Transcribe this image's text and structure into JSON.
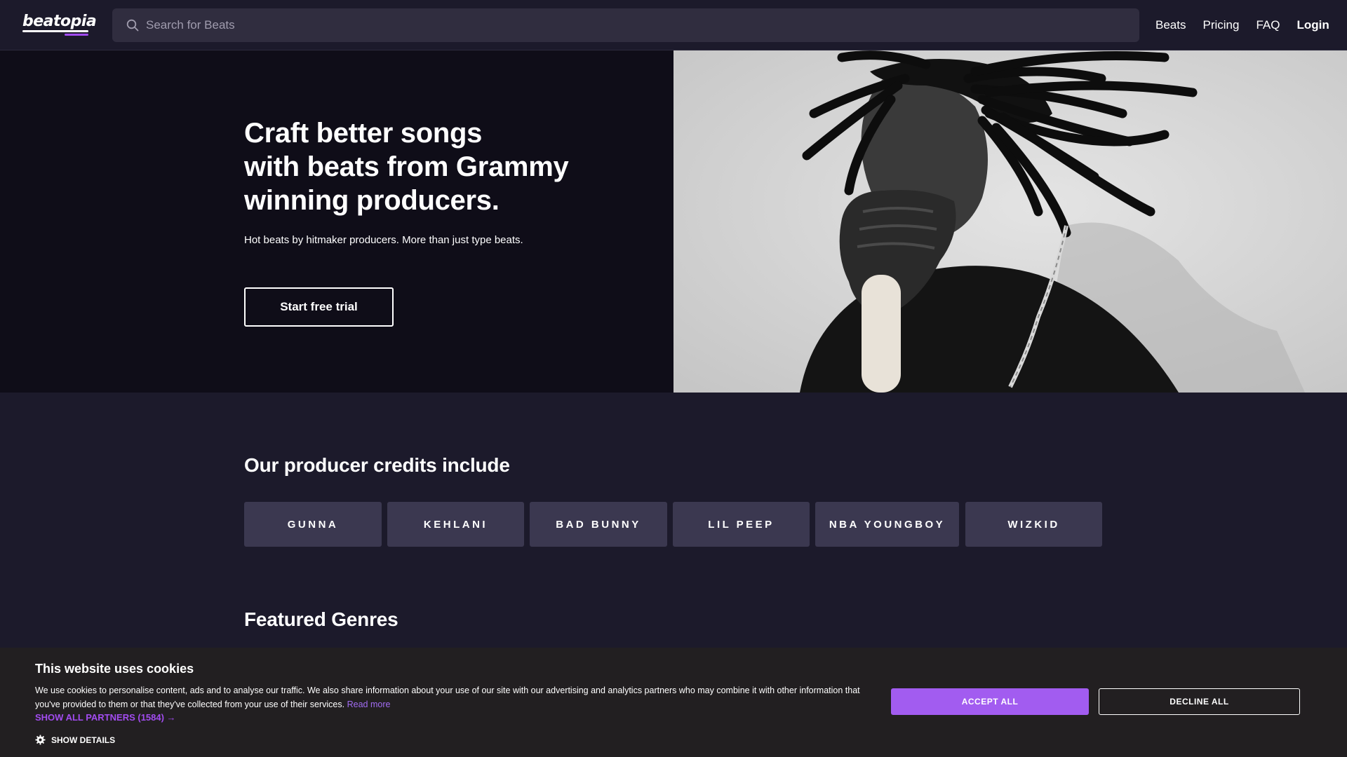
{
  "header": {
    "logo": "beatopia",
    "search_placeholder": "Search for Beats",
    "nav": [
      "Beats",
      "Pricing",
      "FAQ",
      "Login"
    ]
  },
  "hero": {
    "title_lines": [
      "Craft better songs",
      "with beats from Grammy",
      "winning producers."
    ],
    "subtitle": "Hot beats by hitmaker producers. More than just type beats.",
    "cta": "Start free trial"
  },
  "credits": {
    "title": "Our producer credits include",
    "items": [
      "GUNNA",
      "KEHLANI",
      "BAD BUNNY",
      "LIL PEEP",
      "NBA YOUNGBOY",
      "WIZKID"
    ]
  },
  "genres": {
    "title": "Featured Genres"
  },
  "cookie": {
    "title": "This website uses cookies",
    "body": "We use cookies to personalise content, ads and to analyse our traffic. We also share information about your use of our site with our advertising and analytics partners who may combine it with other information that you've provided to them or that they've collected from your use of their services.",
    "read_more": "Read more",
    "partners": "SHOW ALL PARTNERS (1584) →",
    "show_details": "SHOW DETAILS",
    "accept": "ACCEPT ALL",
    "decline": "DECLINE ALL"
  },
  "colors": {
    "background": "#1c1a2b",
    "hero_background": "#0f0d18",
    "accent": "#a24cf0",
    "chip": "#3b3850",
    "cookie_background": "#221f21"
  },
  "icons": [
    "search-icon",
    "gear-icon"
  ]
}
